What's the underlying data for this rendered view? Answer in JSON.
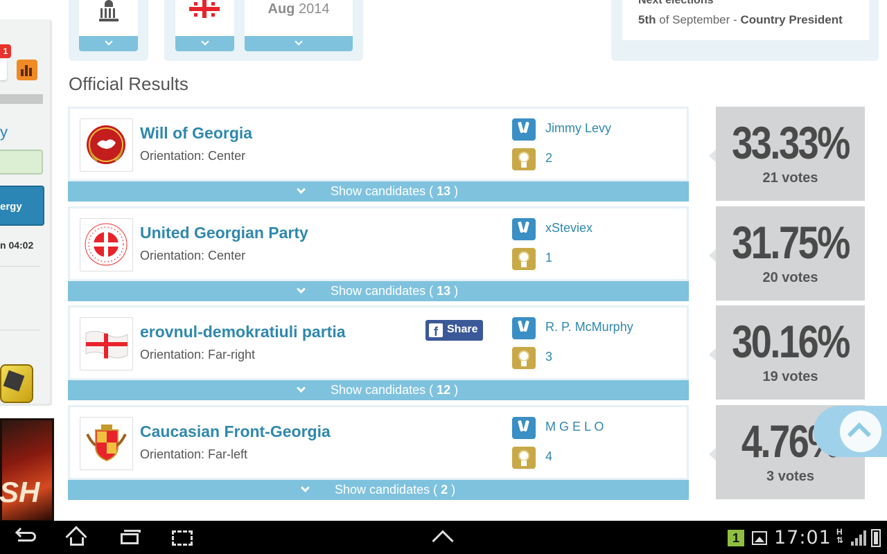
{
  "left_sidebar": {
    "notification_count": "1",
    "partial_letter": "y",
    "energy_label": "ergy",
    "timer_text": "n 04:02",
    "ad_text": "SH"
  },
  "top_cards": {
    "date_month": "Aug",
    "date_year": "2014"
  },
  "next_elections": {
    "title": "Next elections",
    "date_day": "5th",
    "date_rest": "of September",
    "separator": "-",
    "election_type": "Country President"
  },
  "section_title": "Official Results",
  "show_candidates_prefix": "Show candidates (",
  "show_candidates_suffix": ")",
  "share_label": "Share",
  "parties": [
    {
      "name": "Will of Georgia",
      "orientation": "Orientation: Center",
      "leader": "Jimmy Levy",
      "rank": "2",
      "candidates": "13",
      "percent": "33.33%",
      "votes": "21 votes"
    },
    {
      "name": "United Georgian Party",
      "orientation": "Orientation: Center",
      "leader": "xSteviex",
      "rank": "1",
      "candidates": "13",
      "percent": "31.75%",
      "votes": "20 votes"
    },
    {
      "name": "erovnul-demokratiuli partia",
      "orientation": "Orientation: Far-right",
      "leader": "R. P. McMurphy",
      "rank": "3",
      "candidates": "12",
      "percent": "30.16%",
      "votes": "19 votes"
    },
    {
      "name": "Caucasian Front-Georgia",
      "orientation": "Orientation: Far-left",
      "leader": "M G E L O",
      "rank": "4",
      "candidates": "2",
      "percent": "4.76%",
      "votes": "3 votes"
    }
  ],
  "system_bar": {
    "notification_number": "1",
    "time": "17:01",
    "network": "H"
  }
}
